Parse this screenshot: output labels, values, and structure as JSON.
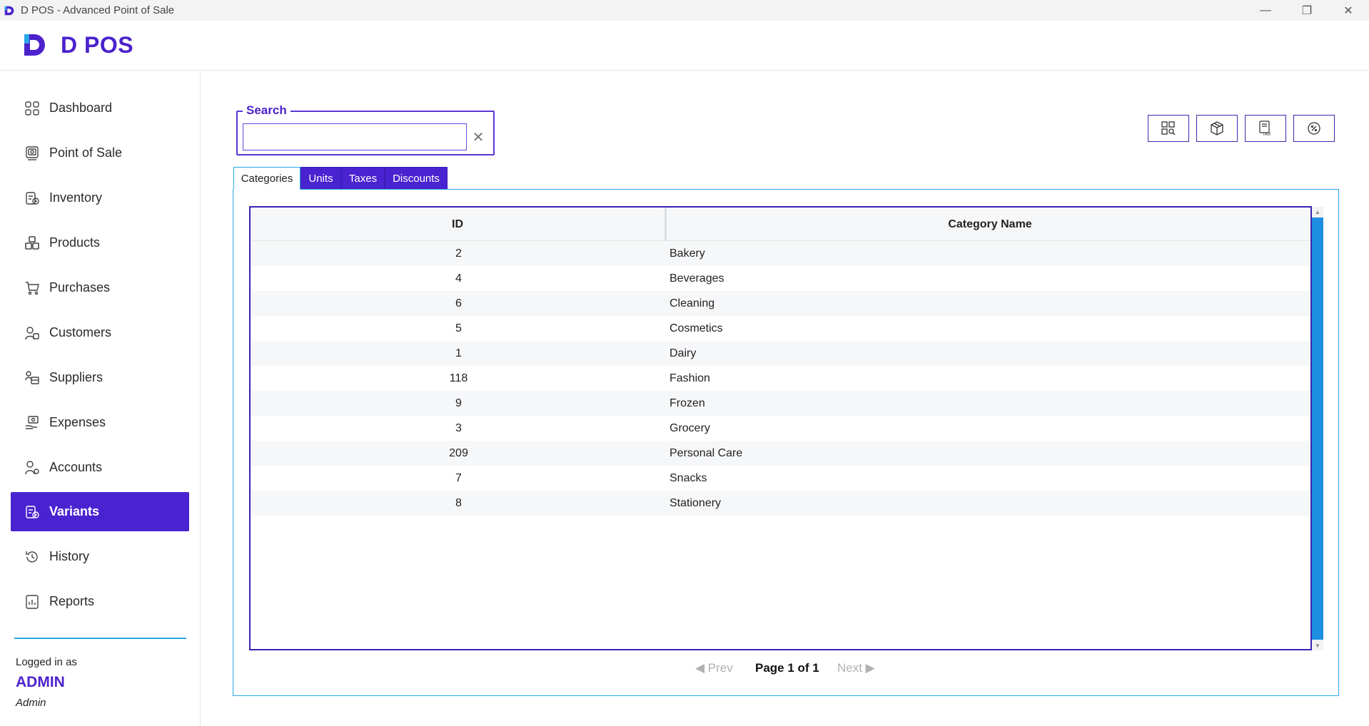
{
  "window": {
    "title": "D POS - Advanced Point of Sale",
    "controls": {
      "minimize": "—",
      "restore": "❐",
      "close": "✕"
    }
  },
  "header": {
    "brand": "D POS"
  },
  "sidebar": {
    "items": [
      {
        "label": "Dashboard",
        "icon": "dashboard-icon"
      },
      {
        "label": "Point of Sale",
        "icon": "pos-terminal-icon"
      },
      {
        "label": "Inventory",
        "icon": "inventory-icon"
      },
      {
        "label": "Products",
        "icon": "products-icon"
      },
      {
        "label": "Purchases",
        "icon": "cart-icon"
      },
      {
        "label": "Customers",
        "icon": "customers-icon"
      },
      {
        "label": "Suppliers",
        "icon": "suppliers-icon"
      },
      {
        "label": "Expenses",
        "icon": "expenses-icon"
      },
      {
        "label": "Accounts",
        "icon": "accounts-icon"
      },
      {
        "label": "Variants",
        "icon": "variants-icon",
        "active": true
      },
      {
        "label": "History",
        "icon": "history-icon"
      },
      {
        "label": "Reports",
        "icon": "reports-icon"
      }
    ],
    "logged_in_label": "Logged in as",
    "user": "ADMIN",
    "role": "Admin"
  },
  "search": {
    "label": "Search",
    "value": "",
    "clear": "✕"
  },
  "toolbar": [
    "category-icon",
    "unit-box-icon",
    "tax-icon",
    "discount-icon"
  ],
  "tabs": [
    {
      "label": "Categories",
      "active": true
    },
    {
      "label": "Units",
      "active": false
    },
    {
      "label": "Taxes",
      "active": false
    },
    {
      "label": "Discounts",
      "active": false
    }
  ],
  "table": {
    "columns": [
      "ID",
      "Category Name"
    ],
    "rows": [
      {
        "id": "2",
        "name": "Bakery"
      },
      {
        "id": "4",
        "name": "Beverages"
      },
      {
        "id": "6",
        "name": "Cleaning"
      },
      {
        "id": "5",
        "name": "Cosmetics"
      },
      {
        "id": "1",
        "name": "Dairy"
      },
      {
        "id": "118",
        "name": "Fashion"
      },
      {
        "id": "9",
        "name": "Frozen"
      },
      {
        "id": "3",
        "name": "Grocery"
      },
      {
        "id": "209",
        "name": "Personal Care"
      },
      {
        "id": "7",
        "name": "Snacks"
      },
      {
        "id": "8",
        "name": "Stationery"
      }
    ]
  },
  "pager": {
    "prev": "◀ Prev",
    "info": "Page 1 of 1",
    "next": "Next ▶"
  },
  "colors": {
    "accent": "#4a23d0",
    "border_blue": "#2aa6e8",
    "scroll": "#1e8fe0"
  }
}
